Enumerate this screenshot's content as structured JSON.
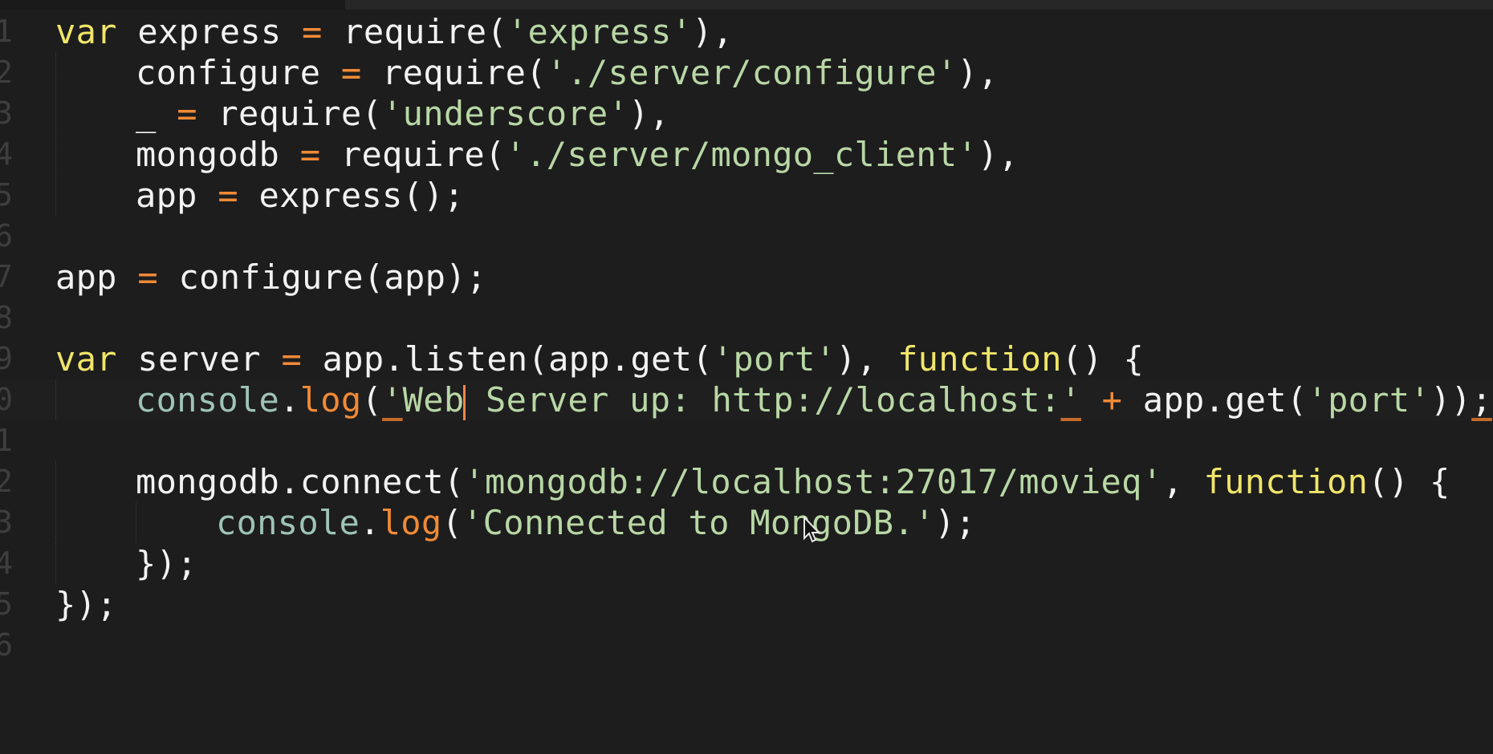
{
  "editor": {
    "lines": [
      {
        "num": "1",
        "tokens": [
          [
            "kw",
            "var"
          ],
          [
            "pl",
            " express "
          ],
          [
            "op",
            "="
          ],
          [
            "pl",
            " require("
          ],
          [
            "str",
            "'express'"
          ],
          [
            "pl",
            "),"
          ]
        ]
      },
      {
        "num": "2",
        "indent": 1,
        "tokens": [
          [
            "pl",
            "configure "
          ],
          [
            "op",
            "="
          ],
          [
            "pl",
            " require("
          ],
          [
            "str",
            "'./server/configure'"
          ],
          [
            "pl",
            "),"
          ]
        ]
      },
      {
        "num": "3",
        "indent": 1,
        "tokens": [
          [
            "pl",
            "_ "
          ],
          [
            "op",
            "="
          ],
          [
            "pl",
            " require("
          ],
          [
            "str",
            "'underscore'"
          ],
          [
            "pl",
            "),"
          ]
        ]
      },
      {
        "num": "4",
        "indent": 1,
        "tokens": [
          [
            "pl",
            "mongodb "
          ],
          [
            "op",
            "="
          ],
          [
            "pl",
            " require("
          ],
          [
            "str",
            "'./server/mongo_client'"
          ],
          [
            "pl",
            "),"
          ]
        ]
      },
      {
        "num": "5",
        "indent": 1,
        "tokens": [
          [
            "pl",
            "app "
          ],
          [
            "op",
            "="
          ],
          [
            "pl",
            " express();"
          ]
        ]
      },
      {
        "num": "6",
        "tokens": []
      },
      {
        "num": "7",
        "tokens": [
          [
            "pl",
            "app "
          ],
          [
            "op",
            "="
          ],
          [
            "pl",
            " configure(app);"
          ]
        ]
      },
      {
        "num": "8",
        "tokens": []
      },
      {
        "num": "9",
        "tokens": [
          [
            "kw",
            "var"
          ],
          [
            "pl",
            " server "
          ],
          [
            "op",
            "="
          ],
          [
            "pl",
            " app.listen(app.get("
          ],
          [
            "str",
            "'port'"
          ],
          [
            "pl",
            "), "
          ],
          [
            "kw",
            "function"
          ],
          [
            "pl",
            "() {"
          ]
        ]
      },
      {
        "num": "0",
        "indent": 1,
        "current": true,
        "tokens": [
          [
            "obj",
            "console"
          ],
          [
            "pl",
            "."
          ],
          [
            "fn",
            "log"
          ],
          [
            "pl",
            "("
          ],
          [
            "str ul",
            "'"
          ],
          [
            "str",
            "Web"
          ],
          [
            "caret",
            ""
          ],
          [
            "str",
            " Server up: http://localhost:"
          ],
          [
            "str ul",
            "'"
          ],
          [
            "pl",
            " "
          ],
          [
            "op",
            "+"
          ],
          [
            "pl",
            " app.get("
          ],
          [
            "str",
            "'port'"
          ],
          [
            "pl",
            "))"
          ],
          [
            "pl ul",
            ";"
          ]
        ]
      },
      {
        "num": "1",
        "tokens": []
      },
      {
        "num": "2",
        "indent": 1,
        "tokens": [
          [
            "pl",
            "mongodb.connect("
          ],
          [
            "str",
            "'mongodb://localhost:27017/movieq'"
          ],
          [
            "pl",
            ", "
          ],
          [
            "kw",
            "function"
          ],
          [
            "pl",
            "() {"
          ]
        ]
      },
      {
        "num": "3",
        "indent": 2,
        "tokens": [
          [
            "obj",
            "console"
          ],
          [
            "pl",
            "."
          ],
          [
            "fn",
            "log"
          ],
          [
            "pl",
            "("
          ],
          [
            "str",
            "'Connected to MongoDB.'"
          ],
          [
            "pl",
            ");"
          ]
        ]
      },
      {
        "num": "4",
        "indent": 1,
        "tokens": [
          [
            "pl",
            "});"
          ]
        ]
      },
      {
        "num": "5",
        "tokens": [
          [
            "pl",
            "});"
          ]
        ]
      },
      {
        "num": "6",
        "tokens": []
      }
    ]
  },
  "colors": {
    "background": "#1d1d1d",
    "keyword": "#f0e56a",
    "operator": "#f08a36",
    "string": "#b8d7a5",
    "object": "#9ec3b8",
    "text": "#f2f2f2",
    "line_number": "#3e3e3e"
  },
  "icons": {
    "mouse_cursor": "arrow-cursor-icon"
  }
}
